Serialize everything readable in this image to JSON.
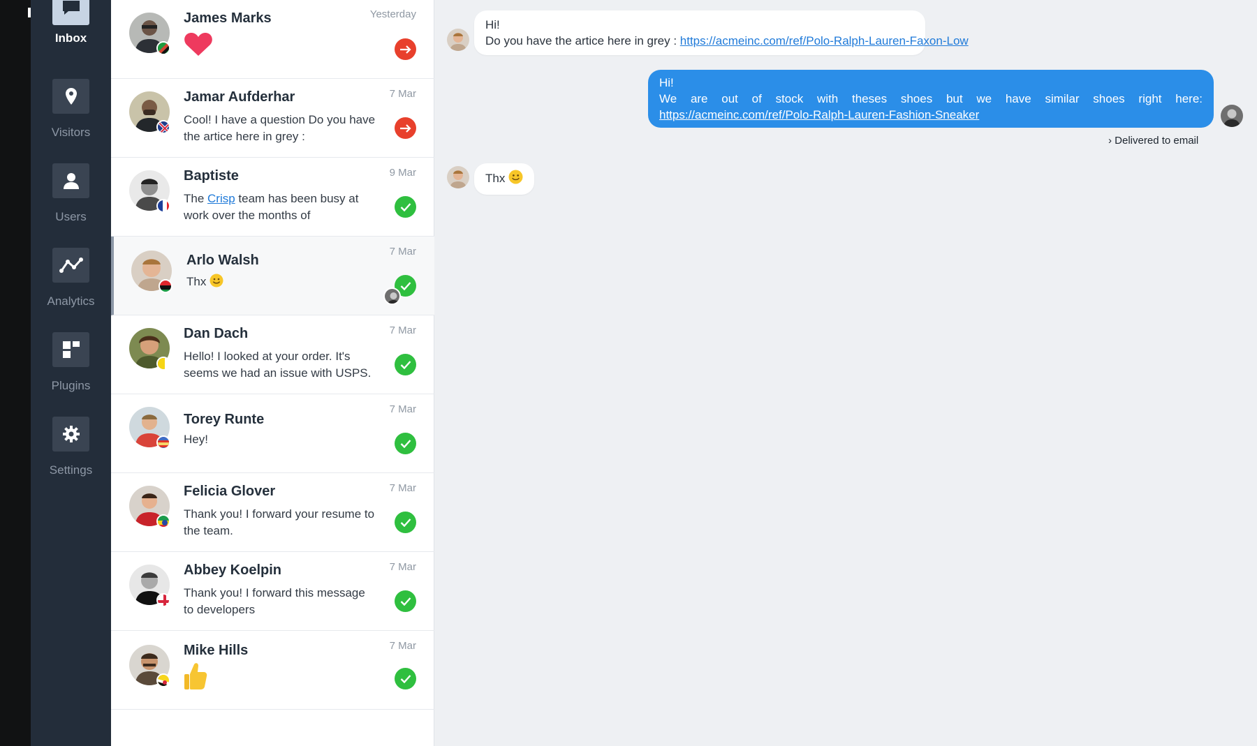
{
  "nav": {
    "items": [
      {
        "label": "Inbox",
        "icon": "chat-bubble-icon",
        "active": true
      },
      {
        "label": "Visitors",
        "icon": "location-pin-icon"
      },
      {
        "label": "Users",
        "icon": "user-icon"
      },
      {
        "label": "Analytics",
        "icon": "analytics-icon"
      },
      {
        "label": "Plugins",
        "icon": "plugins-icon"
      },
      {
        "label": "Settings",
        "icon": "gear-icon"
      }
    ]
  },
  "conversations": [
    {
      "name": "James Marks",
      "date": "Yesterday",
      "snippet": "",
      "snippet_icon": "heart-icon",
      "status": "arrow"
    },
    {
      "name": "Jamar Aufderhar",
      "date": "7 Mar",
      "snippet": "Cool! I have a question Do you have the artice here in grey :",
      "status": "arrow"
    },
    {
      "name": "Baptiste",
      "date": "9 Mar",
      "snippet_pre": "The ",
      "snippet_link": "Crisp",
      "snippet_post": " team has been busy at work over the months of",
      "status": "check"
    },
    {
      "name": "Arlo Walsh",
      "date": "7 Mar",
      "snippet": "Thx",
      "snippet_icon": "smile-emoji-icon",
      "status": "check",
      "selected": true
    },
    {
      "name": "Dan Dach",
      "date": "7 Mar",
      "snippet": "Hello! I looked at your order. It's seems we had an issue with USPS.",
      "status": "check"
    },
    {
      "name": "Torey Runte",
      "date": "7 Mar",
      "snippet": "Hey!",
      "status": "check"
    },
    {
      "name": "Felicia Glover",
      "date": "7 Mar",
      "snippet": "Thank you! I forward your resume to the team.",
      "status": "check"
    },
    {
      "name": "Abbey Koelpin",
      "date": "7 Mar",
      "snippet": "Thank you! I forward this message to developers",
      "status": "check"
    },
    {
      "name": "Mike Hills",
      "date": "7 Mar",
      "snippet": "",
      "snippet_icon": "thumbs-up-icon",
      "status": "check"
    }
  ],
  "chat": {
    "messages": [
      {
        "direction": "in",
        "lines": [
          "Hi!",
          "Do you have the artice here in grey :"
        ],
        "link": "https://acmeinc.com/ref/Polo-Ralph-Lauren-Faxon-Low"
      },
      {
        "direction": "out",
        "lines": [
          "Hi!",
          "We are out of stock with theses shoes but we have similar shoes right here:"
        ],
        "link": "https://acmeinc.com/ref/Polo-Ralph-Lauren-Fashion-Sneaker"
      },
      {
        "direction": "in",
        "lines": [
          "Thx"
        ],
        "icon": "smile-emoji-icon"
      }
    ],
    "delivered": "Delivered to email"
  },
  "colors": {
    "nav_bg": "#232d3a",
    "accent_blue": "#2b8ee8",
    "status_green": "#2fbf3f",
    "status_red": "#e8402c"
  }
}
